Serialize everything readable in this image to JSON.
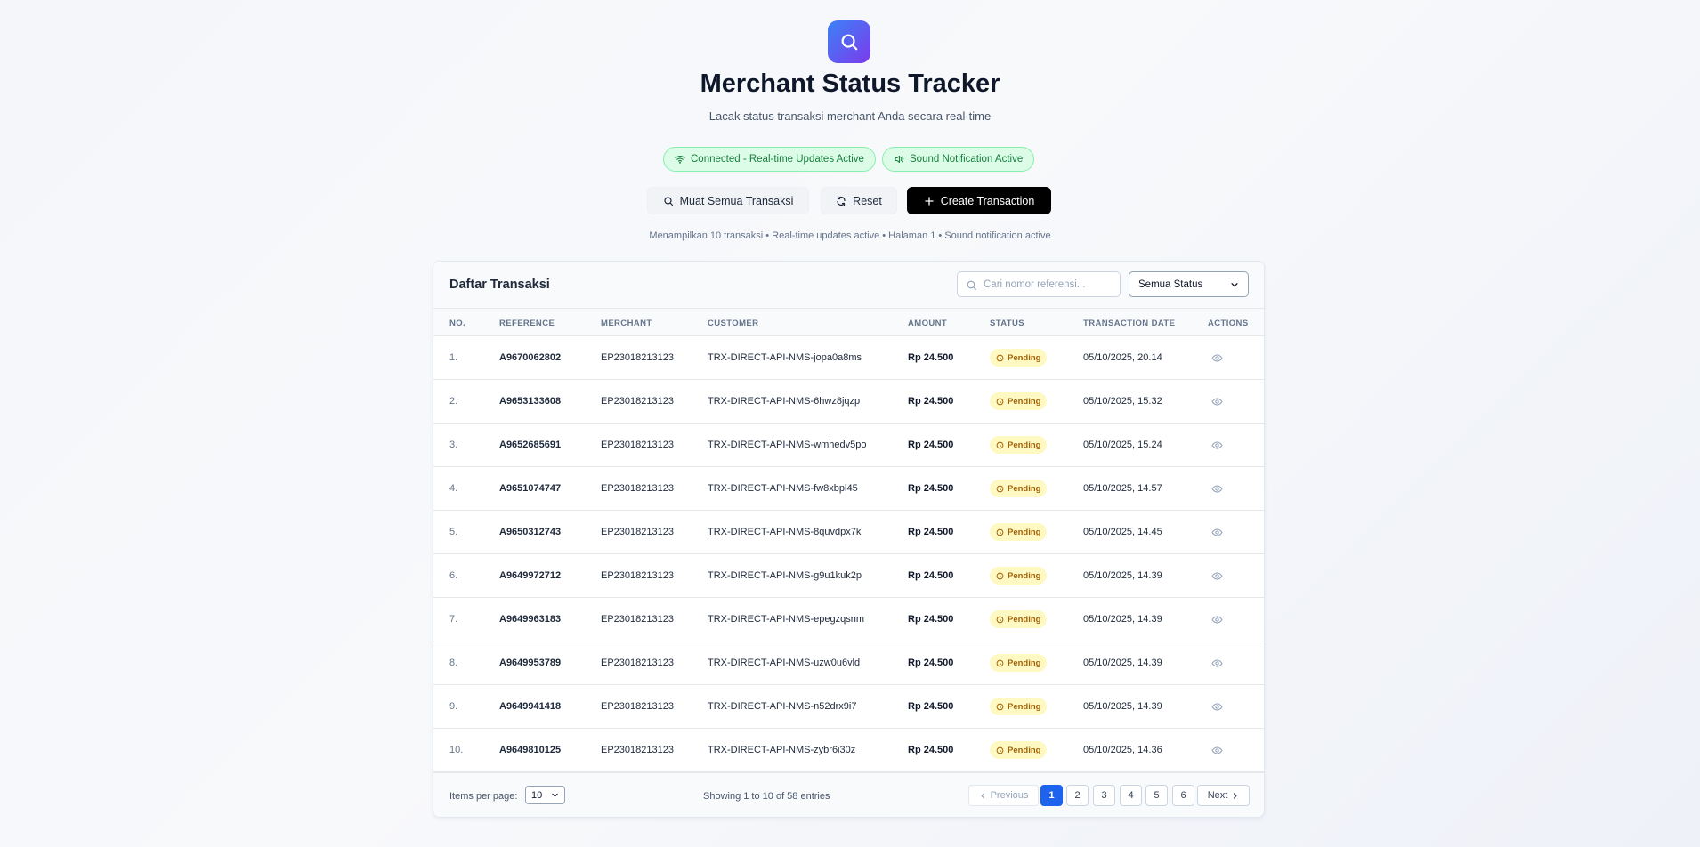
{
  "header": {
    "logo_icon": "search-icon",
    "title": "Merchant Status Tracker",
    "subtitle": "Lacak status transaksi merchant Anda secara real-time"
  },
  "badges": {
    "connection": "Connected - Real-time Updates Active",
    "sound": "Sound Notification Active"
  },
  "actions": {
    "load_all": "Muat Semua Transaksi",
    "reset": "Reset",
    "create": "Create Transaction"
  },
  "summary": "Menampilkan 10 transaksi • Real-time updates active • Halaman 1 • Sound notification active",
  "table": {
    "title": "Daftar Transaksi",
    "search_placeholder": "Cari nomor referensi...",
    "status_filter": "Semua Status",
    "columns": [
      "No.",
      "Reference",
      "Merchant",
      "Customer",
      "Amount",
      "Status",
      "Transaction Date",
      "Actions"
    ],
    "rows": [
      {
        "no": "1.",
        "reference": "A9670062802",
        "merchant": "EP23018213123",
        "customer": "TRX-DIRECT-API-NMS-jopa0a8ms",
        "amount": "Rp 24.500",
        "status": "Pending",
        "date": "05/10/2025, 20.14"
      },
      {
        "no": "2.",
        "reference": "A9653133608",
        "merchant": "EP23018213123",
        "customer": "TRX-DIRECT-API-NMS-6hwz8jqzp",
        "amount": "Rp 24.500",
        "status": "Pending",
        "date": "05/10/2025, 15.32"
      },
      {
        "no": "3.",
        "reference": "A9652685691",
        "merchant": "EP23018213123",
        "customer": "TRX-DIRECT-API-NMS-wmhedv5po",
        "amount": "Rp 24.500",
        "status": "Pending",
        "date": "05/10/2025, 15.24"
      },
      {
        "no": "4.",
        "reference": "A9651074747",
        "merchant": "EP23018213123",
        "customer": "TRX-DIRECT-API-NMS-fw8xbpl45",
        "amount": "Rp 24.500",
        "status": "Pending",
        "date": "05/10/2025, 14.57"
      },
      {
        "no": "5.",
        "reference": "A9650312743",
        "merchant": "EP23018213123",
        "customer": "TRX-DIRECT-API-NMS-8quvdpx7k",
        "amount": "Rp 24.500",
        "status": "Pending",
        "date": "05/10/2025, 14.45"
      },
      {
        "no": "6.",
        "reference": "A9649972712",
        "merchant": "EP23018213123",
        "customer": "TRX-DIRECT-API-NMS-g9u1kuk2p",
        "amount": "Rp 24.500",
        "status": "Pending",
        "date": "05/10/2025, 14.39"
      },
      {
        "no": "7.",
        "reference": "A9649963183",
        "merchant": "EP23018213123",
        "customer": "TRX-DIRECT-API-NMS-epegzqsnm",
        "amount": "Rp 24.500",
        "status": "Pending",
        "date": "05/10/2025, 14.39"
      },
      {
        "no": "8.",
        "reference": "A9649953789",
        "merchant": "EP23018213123",
        "customer": "TRX-DIRECT-API-NMS-uzw0u6vld",
        "amount": "Rp 24.500",
        "status": "Pending",
        "date": "05/10/2025, 14.39"
      },
      {
        "no": "9.",
        "reference": "A9649941418",
        "merchant": "EP23018213123",
        "customer": "TRX-DIRECT-API-NMS-n52drx9i7",
        "amount": "Rp 24.500",
        "status": "Pending",
        "date": "05/10/2025, 14.39"
      },
      {
        "no": "10.",
        "reference": "A9649810125",
        "merchant": "EP23018213123",
        "customer": "TRX-DIRECT-API-NMS-zybr6i30z",
        "amount": "Rp 24.500",
        "status": "Pending",
        "date": "05/10/2025, 14.36"
      }
    ]
  },
  "pagination": {
    "items_per_page_label": "Items per page:",
    "items_per_page_value": "10",
    "showing": "Showing 1 to 10 of 58 entries",
    "previous": "Previous",
    "next": "Next",
    "pages": [
      "1",
      "2",
      "3",
      "4",
      "5",
      "6"
    ],
    "current_page": "1"
  },
  "colors": {
    "accent": "#1d63ed",
    "logo_gradient_start": "#3b82f6",
    "logo_gradient_end": "#7c3aed",
    "success_bg": "#dcfce7",
    "success_text": "#15803d",
    "pending_bg": "#fef9c3",
    "pending_text": "#a16207"
  }
}
